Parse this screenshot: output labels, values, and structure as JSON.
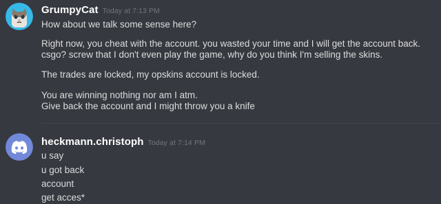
{
  "messages": [
    {
      "author": "GrumpyCat",
      "timestamp": "Today at 7:13 PM",
      "avatar_icon": "grumpy-cat-avatar",
      "lines": [
        "How about we talk some sense here?",
        "Right now, you cheat with the account. you wasted your time and I will get the account back.",
        "csgo? screw that I don't even play the game, why do you think I'm selling the skins.",
        "The trades are locked, my opskins account is locked.",
        "You are winning nothing nor am I atm.",
        "Give back the account and I might throw you a knife"
      ]
    },
    {
      "author": "heckmann.christoph",
      "timestamp": "Today at 7:14 PM",
      "avatar_icon": "discord-logo-avatar",
      "lines": [
        "u say",
        "u got back",
        "account",
        "get acces*"
      ]
    }
  ],
  "colors": {
    "background": "#36393f",
    "text": "#dcddde",
    "username": "#ffffff",
    "timestamp": "#72767d",
    "cat_avatar_bg": "#36b9e8",
    "discord_avatar_bg": "#7289da"
  }
}
